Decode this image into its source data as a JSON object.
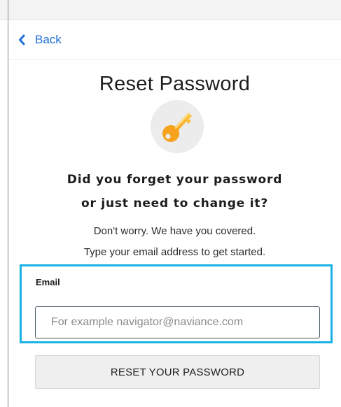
{
  "nav": {
    "back_label": "Back",
    "back_icon": "chevron-left-icon"
  },
  "page": {
    "title": "Reset Password",
    "key_icon": "key-icon",
    "heading_line1": "Did you forget your password",
    "heading_line2": "or just need to change it?",
    "subtext_line1": "Don't worry. We have you covered.",
    "subtext_line2": "Type your email address to get started."
  },
  "form": {
    "email_label": "Email",
    "email_placeholder": "For example navigator@naviance.com",
    "email_value": "",
    "submit_label": "RESET YOUR PASSWORD"
  },
  "colors": {
    "link": "#1f6fd6",
    "focus_highlight": "#1ab2e5",
    "key_gold": "#f5a623"
  }
}
